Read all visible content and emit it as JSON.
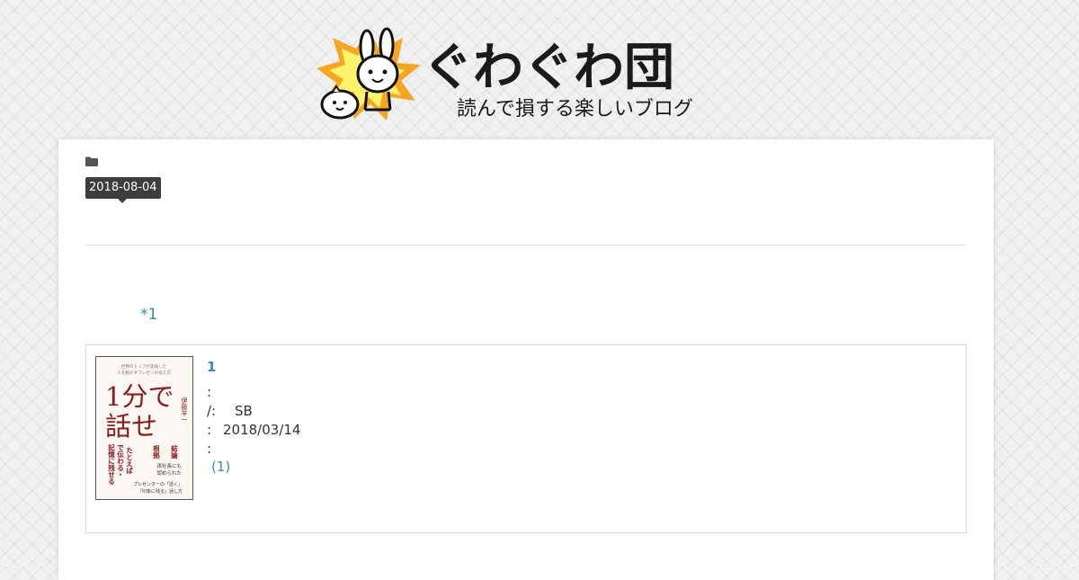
{
  "header": {
    "logo_title": "ぐわぐわ団",
    "logo_subtitle": "読んで損する楽しいブログ"
  },
  "post": {
    "category_icon": "folder-icon",
    "date": "2018-08-04",
    "footnote_ref": "*1"
  },
  "book": {
    "title": "1",
    "cover": {
      "top_lines": [
        "世界のトップが実践した",
        "人を動かすプレゼンの伝え方"
      ],
      "main_line_1": "1分で",
      "main_line_2": "話せ",
      "author": "伊藤羊一",
      "col_1": "記憶に残せる",
      "col_2": "で伝わる・",
      "col_3": "たとえば",
      "col_4": "根拠",
      "col_5": "結論",
      "side_1": "孫社長にも",
      "side_2": "認められた",
      "bottom_1": "プレゼンターの「話く」",
      "bottom_2": "「印象に残る」話し方"
    },
    "meta": {
      "line_1_label": ":",
      "line_2_label": "/:",
      "line_2_value": "SB",
      "line_3_label": ":",
      "line_3_value": "2018/03/14",
      "line_4_label": ":",
      "review_link": "(1)"
    }
  },
  "colors": {
    "link": "#3a8ab5",
    "badge": "#3d3d3d",
    "cover_red": "#8b1a1a",
    "burst": "#f5a623"
  }
}
